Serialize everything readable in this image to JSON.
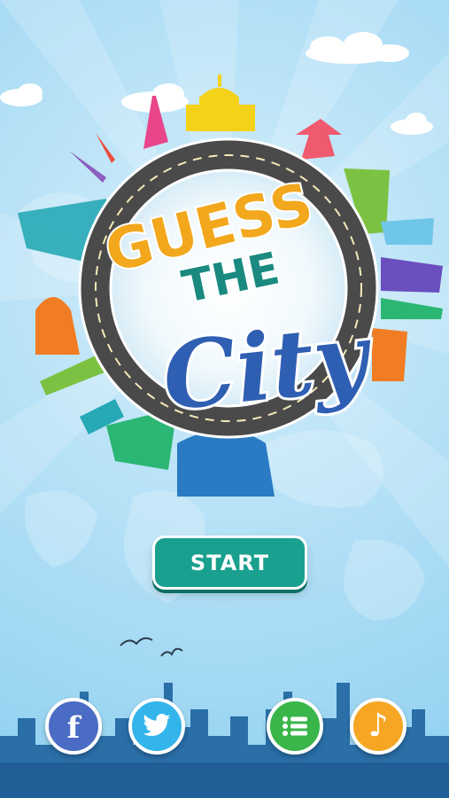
{
  "title": {
    "line1": "GUESS",
    "line2": "THE",
    "line3": "City"
  },
  "start_button": {
    "label": "START"
  },
  "social": {
    "facebook": {
      "icon": "facebook-icon",
      "color": "#4a6cc4",
      "glyph": "f"
    },
    "twitter": {
      "icon": "twitter-icon",
      "color": "#33b4ea"
    },
    "list": {
      "icon": "list-icon",
      "color": "#39b54a"
    },
    "music": {
      "icon": "music-note-icon",
      "color": "#f6a623",
      "glyph": "♪"
    }
  },
  "colors": {
    "sky": "#b8e2f7",
    "road": "#4a4a4a",
    "title_orange": "#f2a71d",
    "title_teal": "#1a8a80",
    "title_blue": "#2f5fb3",
    "start_button": "#1aa08f",
    "skyline": "#2a6fa8"
  }
}
